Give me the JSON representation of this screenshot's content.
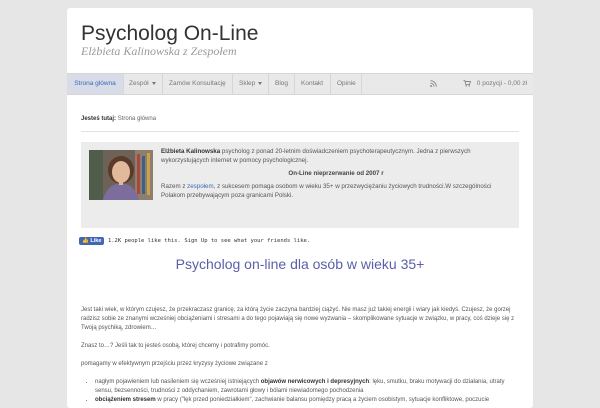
{
  "header": {
    "title": "Psycholog On-Line",
    "tagline": "Elżbieta Kalinowska z Zespołem"
  },
  "nav": {
    "items": [
      {
        "label": "Strona główna",
        "active": true
      },
      {
        "label": "Zespół",
        "dropdown": true
      },
      {
        "label": "Zamów Konsultację"
      },
      {
        "label": "Sklep",
        "dropdown": true
      },
      {
        "label": "Blog"
      },
      {
        "label": "Kontakt"
      },
      {
        "label": "Opinie"
      }
    ],
    "rss_icon": "rss-icon",
    "cart_icon": "cart-icon",
    "cart_label": "0 pozycji - 0,00 zł"
  },
  "breadcrumb": {
    "prefix": "Jesteś tutaj:",
    "current": "Strona główna"
  },
  "intro": {
    "name": "Elżbieta Kalinowska",
    "p1": " psycholog z ponad 20-letnim doświadczeniem psychoterapeutycznym. Jedna z pierwszych  wykorzystujących internet w pomocy psychologicznej.",
    "highlight": "On-Line nieprzerwanie od 2007 r",
    "p2_before": "Razem z ",
    "p2_link": "zespołem",
    "p2_after": ", z sukcesem pomaga osobom w wieku 35+ w przezwyciężaniu życiowych trudności.W szczególności Polakom przebywającym poza granicami Polski."
  },
  "social": {
    "like_label": "Like",
    "like_text": "1.2K people like this.",
    "signup_text": "Sign Up to see what your friends like."
  },
  "main": {
    "headline": "Psycholog on-line dla osób w wieku 35+",
    "p1": "Jest taki wiek, w którym  czujesz, że przekraczasz granicę, za którą życie zaczyna bardziej ciążyć. Nie masz już takiej energii i wiary jak kiedyś. Czujesz, że gorzej radzisz sobie ze znanymi wcześniej obciążeniami i stresami a do tego pojawiają się nowe wyzwania – skomplikowane sytuacje w związku, w pracy, coś dzieje się z Twoją psychiką, zdrowiem…",
    "p2": "Znasz to…? Jeśli tak to jesteś osobą, której chcemy i potrafimy pomóc.",
    "p3": "pomagamy w efektywnym przejściu przez kryzysy życiowe związane z",
    "li1_before": "nagłym pojawieniem lub nasileniem się wcześniej istniejących ",
    "li1_bold": "objawów nerwicowych i depresyjnych",
    "li1_after": ": lęku, smutku, braku motywacji do działania, utraty sensu,  bezsenności, trudności z oddychaniem, zawrotami głowy i bólami niewiadomego pochodzenia",
    "li2_bold": "obciążeniem stresem",
    "li2_after": " w pracy (\"lęk przed poniedziałkiem\", zachwianie balansu pomiędzy pracą a życiem osobistym, sytuacje konfliktowe, poczucie"
  }
}
